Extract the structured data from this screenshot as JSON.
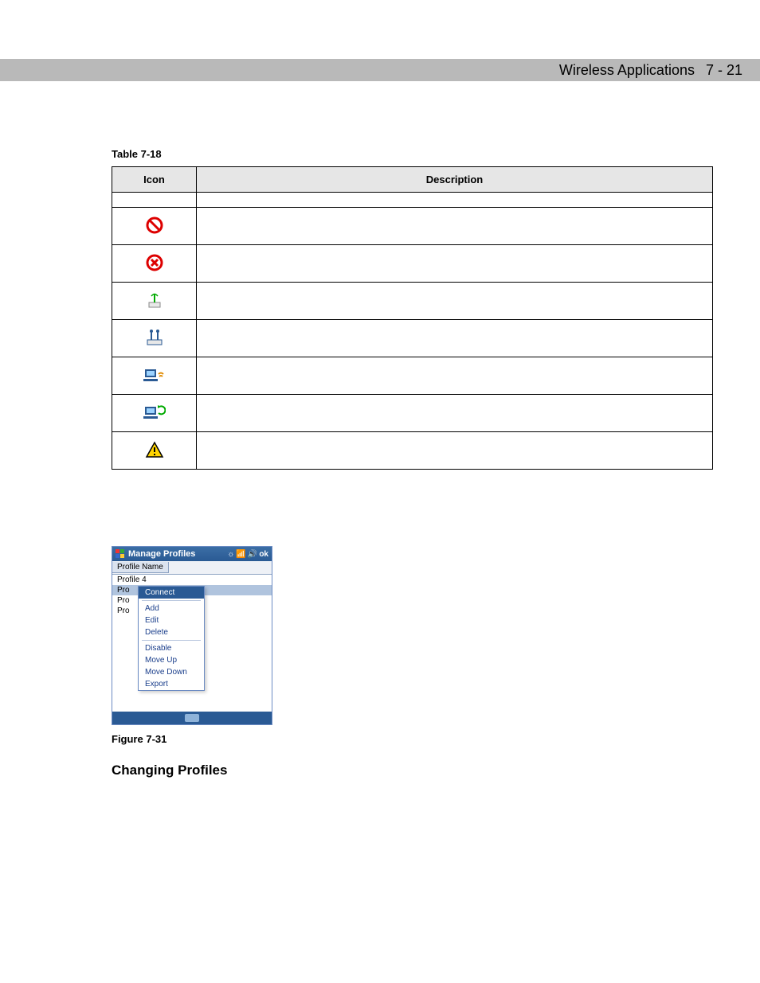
{
  "header": {
    "section_title": "Wireless Applications",
    "page_indicator": "7 - 21"
  },
  "table": {
    "caption": "Table 7-18",
    "col_icon": "Icon",
    "col_desc": "Description"
  },
  "manage_profiles": {
    "title": "Manage Profiles",
    "ok": "ok",
    "column_header": "Profile Name",
    "items": [
      "Profile 4",
      "Pro",
      "Pro",
      "Pro"
    ],
    "menu": {
      "connect": "Connect",
      "add": "Add",
      "edit": "Edit",
      "delete": "Delete",
      "disable": "Disable",
      "move_up": "Move Up",
      "move_down": "Move Down",
      "export": "Export"
    }
  },
  "figure_caption": "Figure 7-31",
  "heading_changing": "Changing Profiles"
}
